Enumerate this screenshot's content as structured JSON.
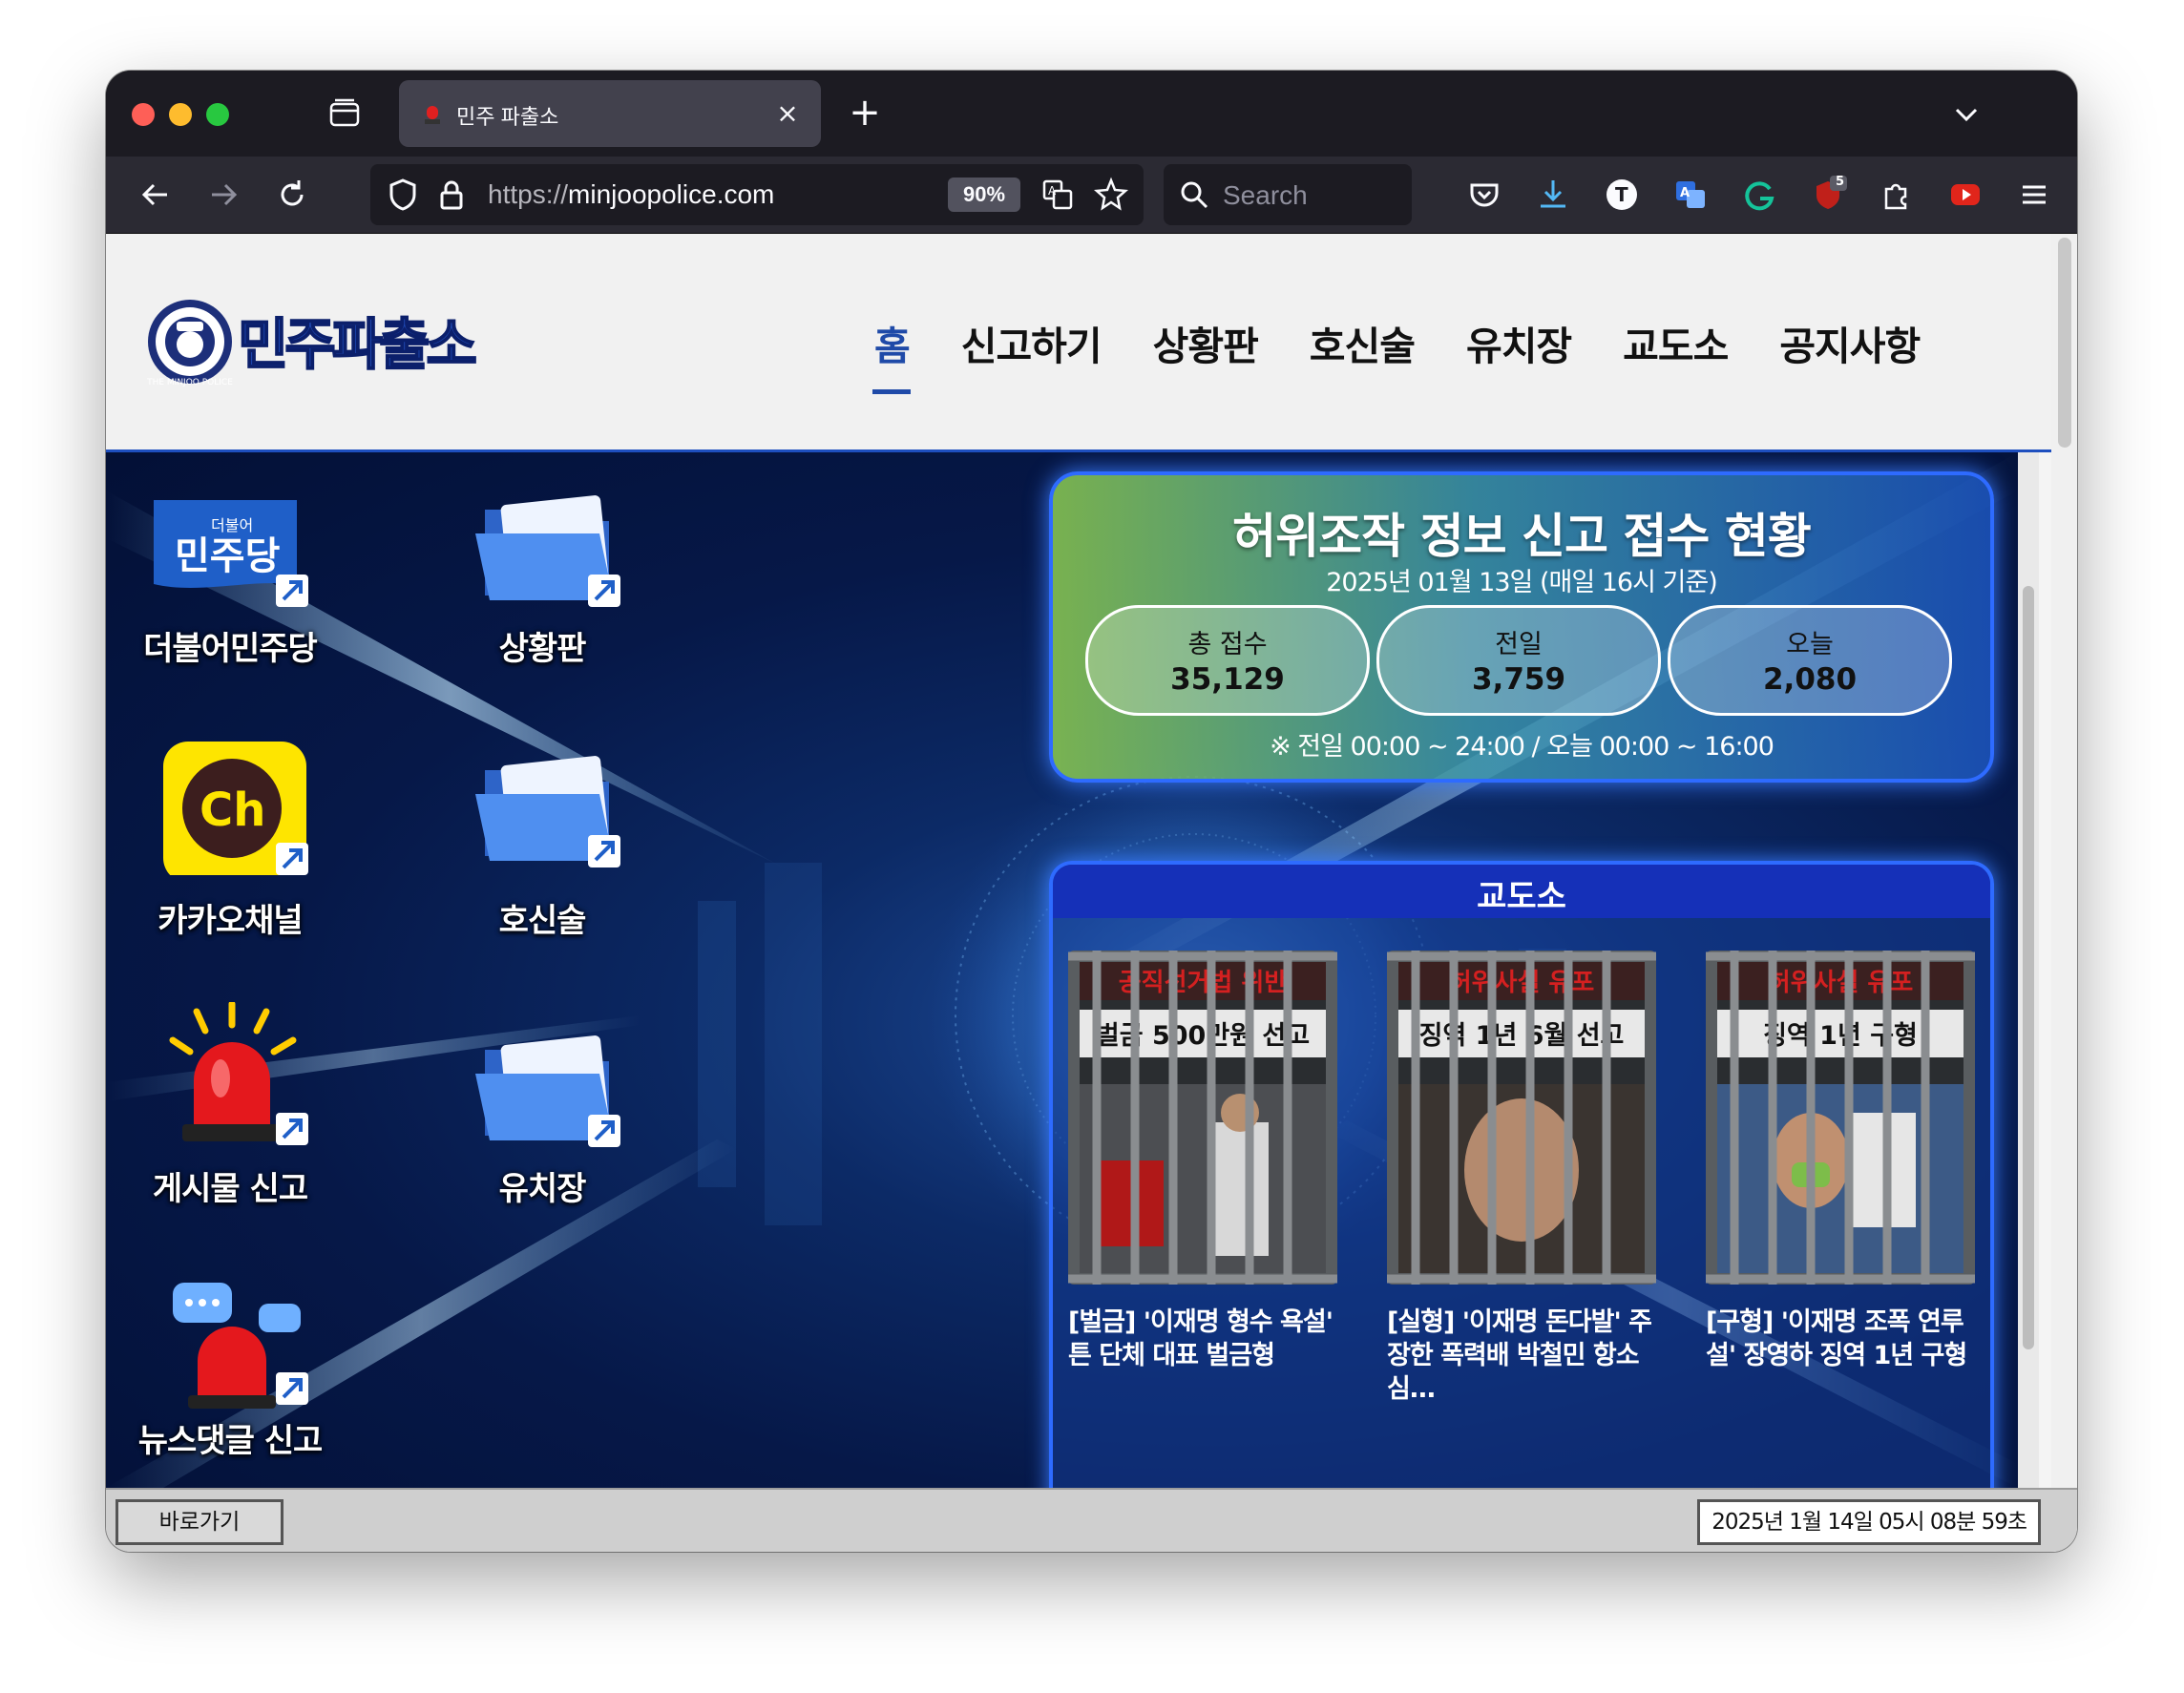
{
  "browser": {
    "tab_title": "민주 파출소",
    "url_scheme": "https://",
    "url_host": "minjoopolice.com",
    "zoom": "90%",
    "search_placeholder": "Search",
    "extension_badge": "5"
  },
  "site": {
    "logo_text": "민주파출소",
    "logo_badge_text": "THE MINJOO POLICE",
    "nav": [
      "홈",
      "신고하기",
      "상황판",
      "호신술",
      "유치장",
      "교도소",
      "공지사항"
    ],
    "active_nav": "홈"
  },
  "desktop_icons": [
    {
      "label": "더불어민주당",
      "icon": "minjoo-party-logo",
      "logo_small": "더불어",
      "logo_big": "민주당"
    },
    {
      "label": "상황판",
      "icon": "folder-icon"
    },
    {
      "label": "카카오채널",
      "icon": "kakao-channel-icon",
      "logo_text": "Ch"
    },
    {
      "label": "호신술",
      "icon": "folder-icon"
    },
    {
      "label": "게시물 신고",
      "icon": "siren-icon"
    },
    {
      "label": "유치장",
      "icon": "folder-icon"
    },
    {
      "label": "뉴스댓글 신고",
      "icon": "siren-chat-icon"
    }
  ],
  "stats": {
    "title": "허위조작 정보 신고 접수 현황",
    "subtitle": "2025년 01월 13일 (매일 16시 기준)",
    "items": [
      {
        "label": "총 접수",
        "value": "35,129"
      },
      {
        "label": "전일",
        "value": "3,759"
      },
      {
        "label": "오늘",
        "value": "2,080"
      }
    ],
    "note": "※ 전일 00:00 ~ 24:00 / 오늘 00:00 ~ 16:00"
  },
  "prison": {
    "title": "교도소",
    "cards": [
      {
        "banner": "공직선거법 위반",
        "headline": "벌금 500만원 선고",
        "caption": "[벌금] '이재명 형수 욕설' 튼 단체 대표 벌금형"
      },
      {
        "banner": "허위사실 유포",
        "headline": "징역 1년 6월 선고",
        "caption": "[실형] '이재명 돈다발' 주장한 폭력배 박철민 항소심…"
      },
      {
        "banner": "허위사실 유포",
        "headline": "징역 1년 구형",
        "caption": "[구형] '이재명 조폭 연루설' 장영하 징역 1년 구형"
      }
    ]
  },
  "statusbar": {
    "back_button": "바로가기",
    "clock": "2025년 1월 14일 05시 08분 59초"
  },
  "colors": {
    "accent": "#1f4aa8",
    "panel_border": "#2e6bff",
    "prison_header": "#1530b8"
  }
}
